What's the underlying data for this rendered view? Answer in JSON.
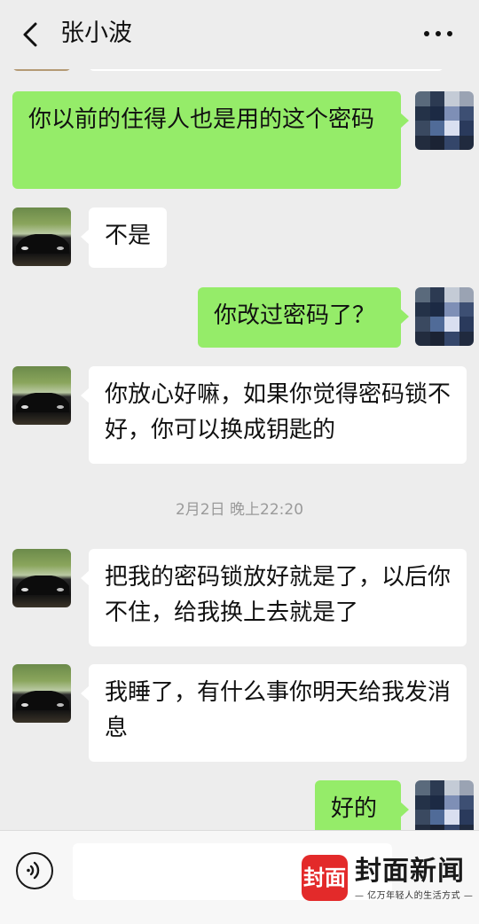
{
  "header": {
    "title": "张小波"
  },
  "messages": [
    {
      "side": "right",
      "text": "你以前的住得人也是用的这个密码"
    },
    {
      "side": "left",
      "text": "不是"
    },
    {
      "side": "right",
      "text": "你改过密码了？"
    },
    {
      "side": "left",
      "text": "你放心好嘛，如果你觉得密码锁不好，你可以换成钥匙的"
    },
    {
      "side": "left",
      "text": "把我的密码锁放好就是了，以后你不住，给我换上去就是了"
    },
    {
      "side": "left",
      "text": "我睡了，有什么事你明天给我发消息"
    },
    {
      "side": "right",
      "text": "好的"
    }
  ],
  "timestamp": "2月2日 晚上22:20",
  "watermark": {
    "logo": "封面",
    "name": "封面新闻",
    "slogan": "— 亿万年轻人的生活方式 —"
  },
  "colors": {
    "self_bubble": "#95ec69",
    "other_bubble": "#ffffff",
    "background": "#ededed",
    "watermark_red": "#e32a2a"
  },
  "icons": [
    "back-arrow-icon",
    "more-dots-icon",
    "voice-icon"
  ]
}
